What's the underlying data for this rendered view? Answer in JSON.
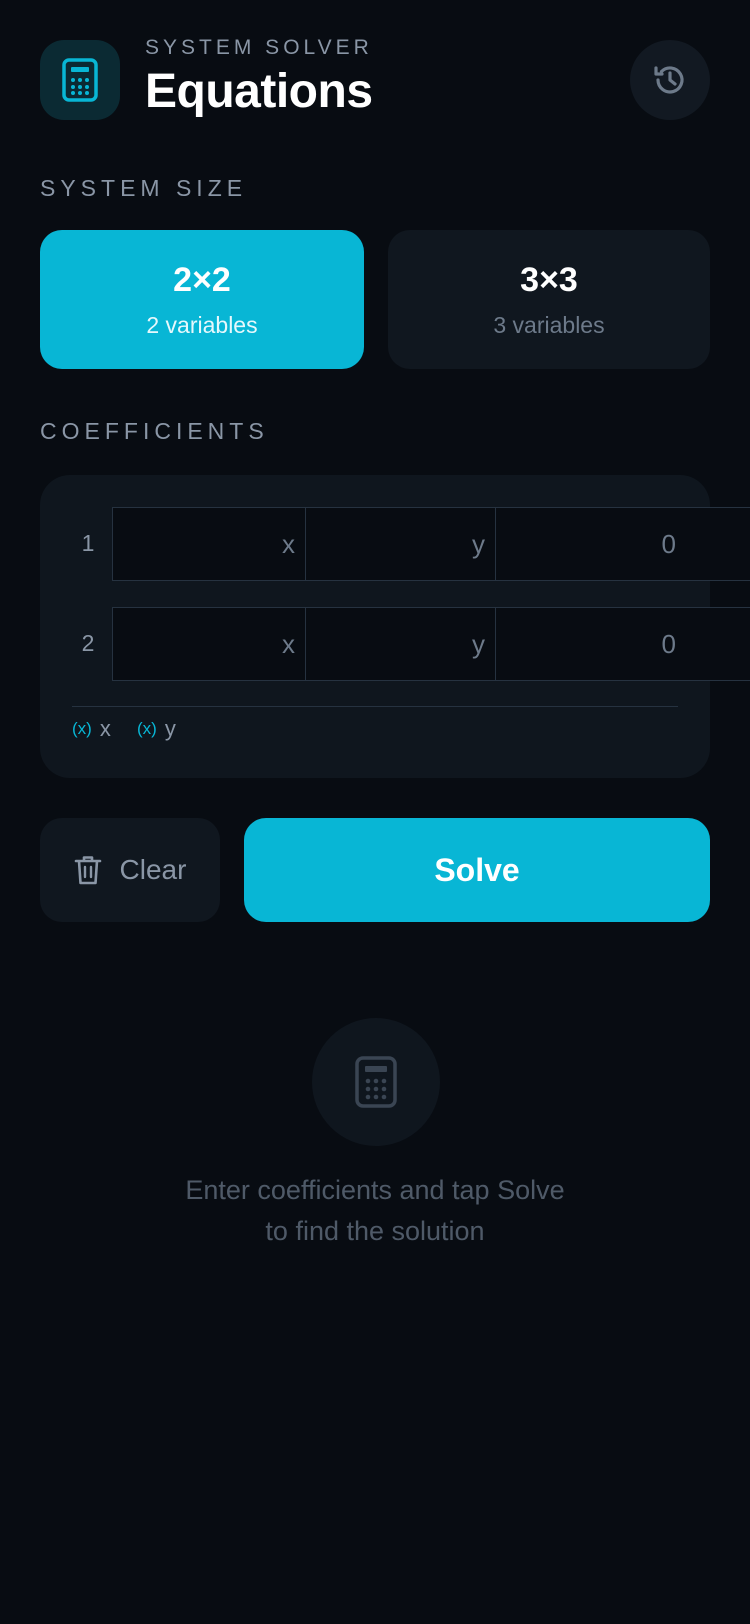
{
  "header": {
    "eyebrow": "SYSTEM SOLVER",
    "title": "Equations",
    "app_icon": "calculator-icon",
    "history_icon": "history-icon"
  },
  "system_size": {
    "label": "SYSTEM SIZE",
    "options": [
      {
        "title": "2×2",
        "subtitle": "2 variables",
        "selected": true
      },
      {
        "title": "3×3",
        "subtitle": "3 variables",
        "selected": false
      }
    ]
  },
  "coefficients": {
    "label": "COEFFICIENTS",
    "rows": [
      {
        "number": "1",
        "x_suffix": "x",
        "y_suffix": "y",
        "constant": "0"
      },
      {
        "number": "2",
        "x_suffix": "x",
        "y_suffix": "y",
        "constant": "0"
      }
    ],
    "legend": [
      {
        "symbol": "(x)",
        "label": "x"
      },
      {
        "symbol": "(x)",
        "label": "y"
      }
    ]
  },
  "actions": {
    "clear_label": "Clear",
    "clear_icon": "trash-icon",
    "solve_label": "Solve"
  },
  "empty_state": {
    "icon": "calculator-icon",
    "line1": "Enter coefficients and tap Solve",
    "line2": "to find the solution"
  },
  "colors": {
    "background": "#080c12",
    "accent": "#08b6d5",
    "card": "#10171f"
  }
}
